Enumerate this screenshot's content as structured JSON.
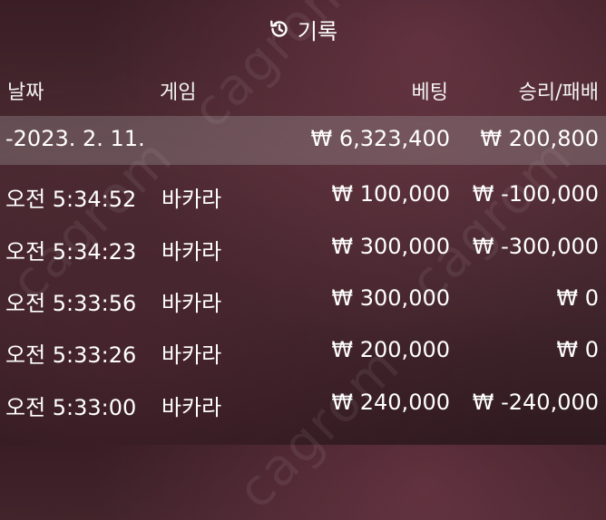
{
  "header": {
    "title": "기록",
    "icon": "history-icon"
  },
  "columns": {
    "date": "날짜",
    "game": "게임",
    "bet": "베팅",
    "result": "승리/패배"
  },
  "date_group": {
    "date": "-2023. 2. 11.",
    "bet_total": "₩ 6,323,400",
    "result_total": "₩ 200,800"
  },
  "rows": [
    {
      "time": "오전 5:34:52",
      "game": "바카라",
      "bet": "₩ 100,000",
      "result": "₩ -100,000"
    },
    {
      "time": "오전 5:34:23",
      "game": "바카라",
      "bet": "₩ 300,000",
      "result": "₩ -300,000"
    },
    {
      "time": "오전 5:33:56",
      "game": "바카라",
      "bet": "₩ 300,000",
      "result": "₩ 0"
    },
    {
      "time": "오전 5:33:26",
      "game": "바카라",
      "bet": "₩ 200,000",
      "result": "₩ 0"
    },
    {
      "time": "오전 5:33:00",
      "game": "바카라",
      "bet": "₩ 240,000",
      "result": "₩ -240,000"
    }
  ],
  "watermark": "cagrom"
}
